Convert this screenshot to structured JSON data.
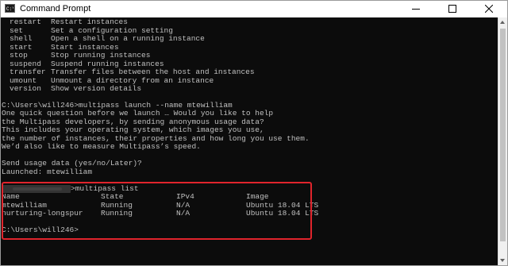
{
  "window": {
    "title": "Command Prompt",
    "icon": "cmd-icon",
    "buttons": [
      "minimize-icon",
      "maximize-icon",
      "close-icon"
    ]
  },
  "help": [
    {
      "cmd": "restart",
      "desc": "Restart instances"
    },
    {
      "cmd": "set",
      "desc": "Set a configuration setting"
    },
    {
      "cmd": "shell",
      "desc": "Open a shell on a running instance"
    },
    {
      "cmd": "start",
      "desc": "Start instances"
    },
    {
      "cmd": "stop",
      "desc": "Stop running instances"
    },
    {
      "cmd": "suspend",
      "desc": "Suspend running instances"
    },
    {
      "cmd": "transfer",
      "desc": "Transfer files between the host and instances"
    },
    {
      "cmd": "umount",
      "desc": "Unmount a directory from an instance"
    },
    {
      "cmd": "version",
      "desc": "Show version details"
    }
  ],
  "launch": {
    "prompt": "C:\\Users\\will246>multipass launch --name mtewilliam",
    "question_lines": [
      "One quick question before we launch … Would you like to help",
      "the Multipass developers, by sending anonymous usage data?",
      "This includes your operating system, which images you use,",
      "the number of instances, their properties and how long you use them.",
      "We’d also like to measure Multipass’s speed."
    ],
    "usage_prompt": "Send usage data (yes/no/Later)?",
    "launched": "Launched: mtewilliam"
  },
  "list": {
    "command": ">multipass list",
    "headers": {
      "name": "Name",
      "state": "State",
      "ipv4": "IPv4",
      "image": "Image"
    },
    "rows": [
      {
        "name": "mtewilliam",
        "state": "Running",
        "ipv4": "N/A",
        "image": "Ubuntu 18.04 LTS"
      },
      {
        "name": "nurturing-longspur",
        "state": "Running",
        "ipv4": "N/A",
        "image": "Ubuntu 18.04 LTS"
      }
    ],
    "final_prompt": "C:\\Users\\will246>"
  },
  "colors": {
    "console_bg": "#0c0c0c",
    "console_text": "#c0c0c0",
    "highlight": "#e0242c"
  }
}
